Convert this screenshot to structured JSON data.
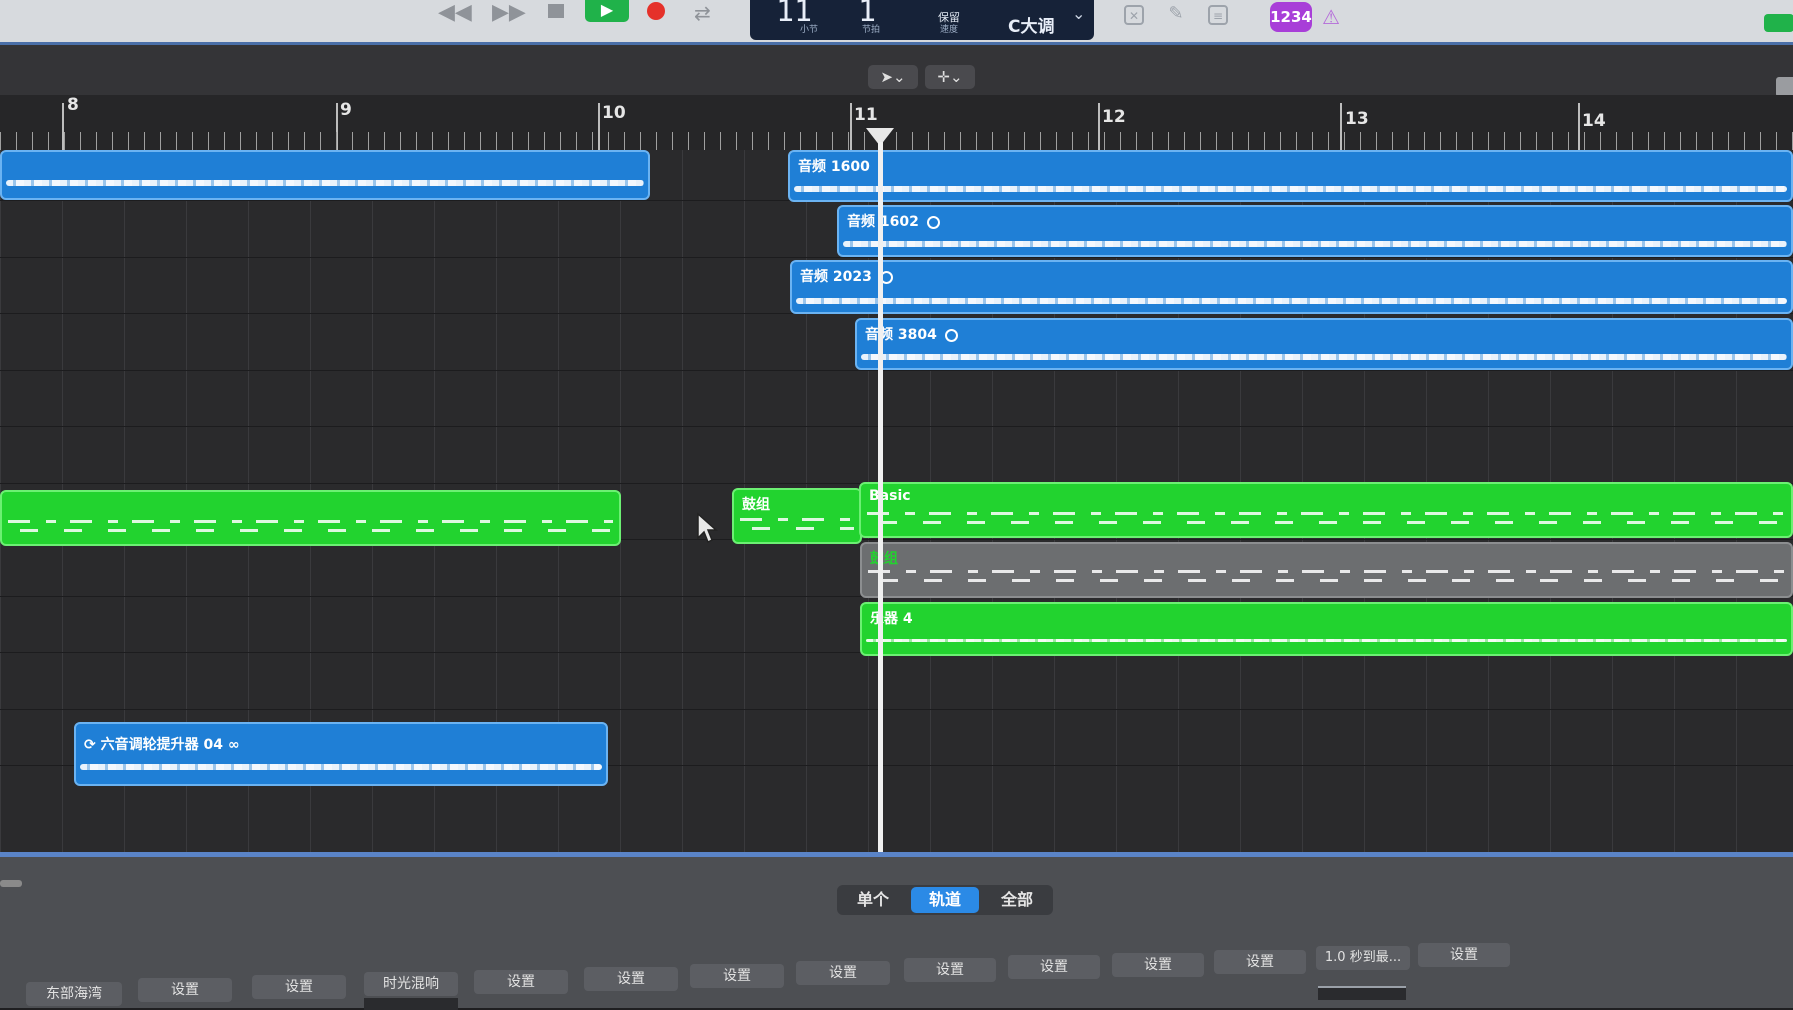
{
  "toolbar": {
    "lcd": {
      "bar": "11",
      "beat": "1",
      "bar_label": "小节",
      "beat_label": "节拍",
      "tempo_label": "保留",
      "tempo_sub": "速度",
      "key": "C大调"
    },
    "count_in_badge": "1234"
  },
  "ruler": {
    "bars": [
      "8",
      "9",
      "10",
      "11",
      "12",
      "13",
      "14"
    ]
  },
  "regions": {
    "audio_1600": "音频 1600",
    "audio_1602": "音频 1602",
    "audio_2023": "音频 2023",
    "audio_3804": "音频 3804",
    "loop_clip": "六音调轮提升器 04",
    "drums_a": "鼓组",
    "drums_basic": "Basic",
    "gray_clip": "鼓组",
    "synth_4": "乐器 4"
  },
  "inspector": {
    "tabs": [
      "单个",
      "轨道",
      "全部"
    ],
    "active_tab": "轨道",
    "params": [
      "东部海湾",
      "设置",
      "设置",
      "时光混响",
      "设置",
      "设置",
      "设置",
      "设置",
      "设置",
      "设置",
      "设置",
      "设置",
      "1.0 秒到最...",
      "设置"
    ]
  },
  "colors": {
    "audio": "#1f7fd6",
    "midi": "#22d32f",
    "accent": "#2b8ae6"
  }
}
